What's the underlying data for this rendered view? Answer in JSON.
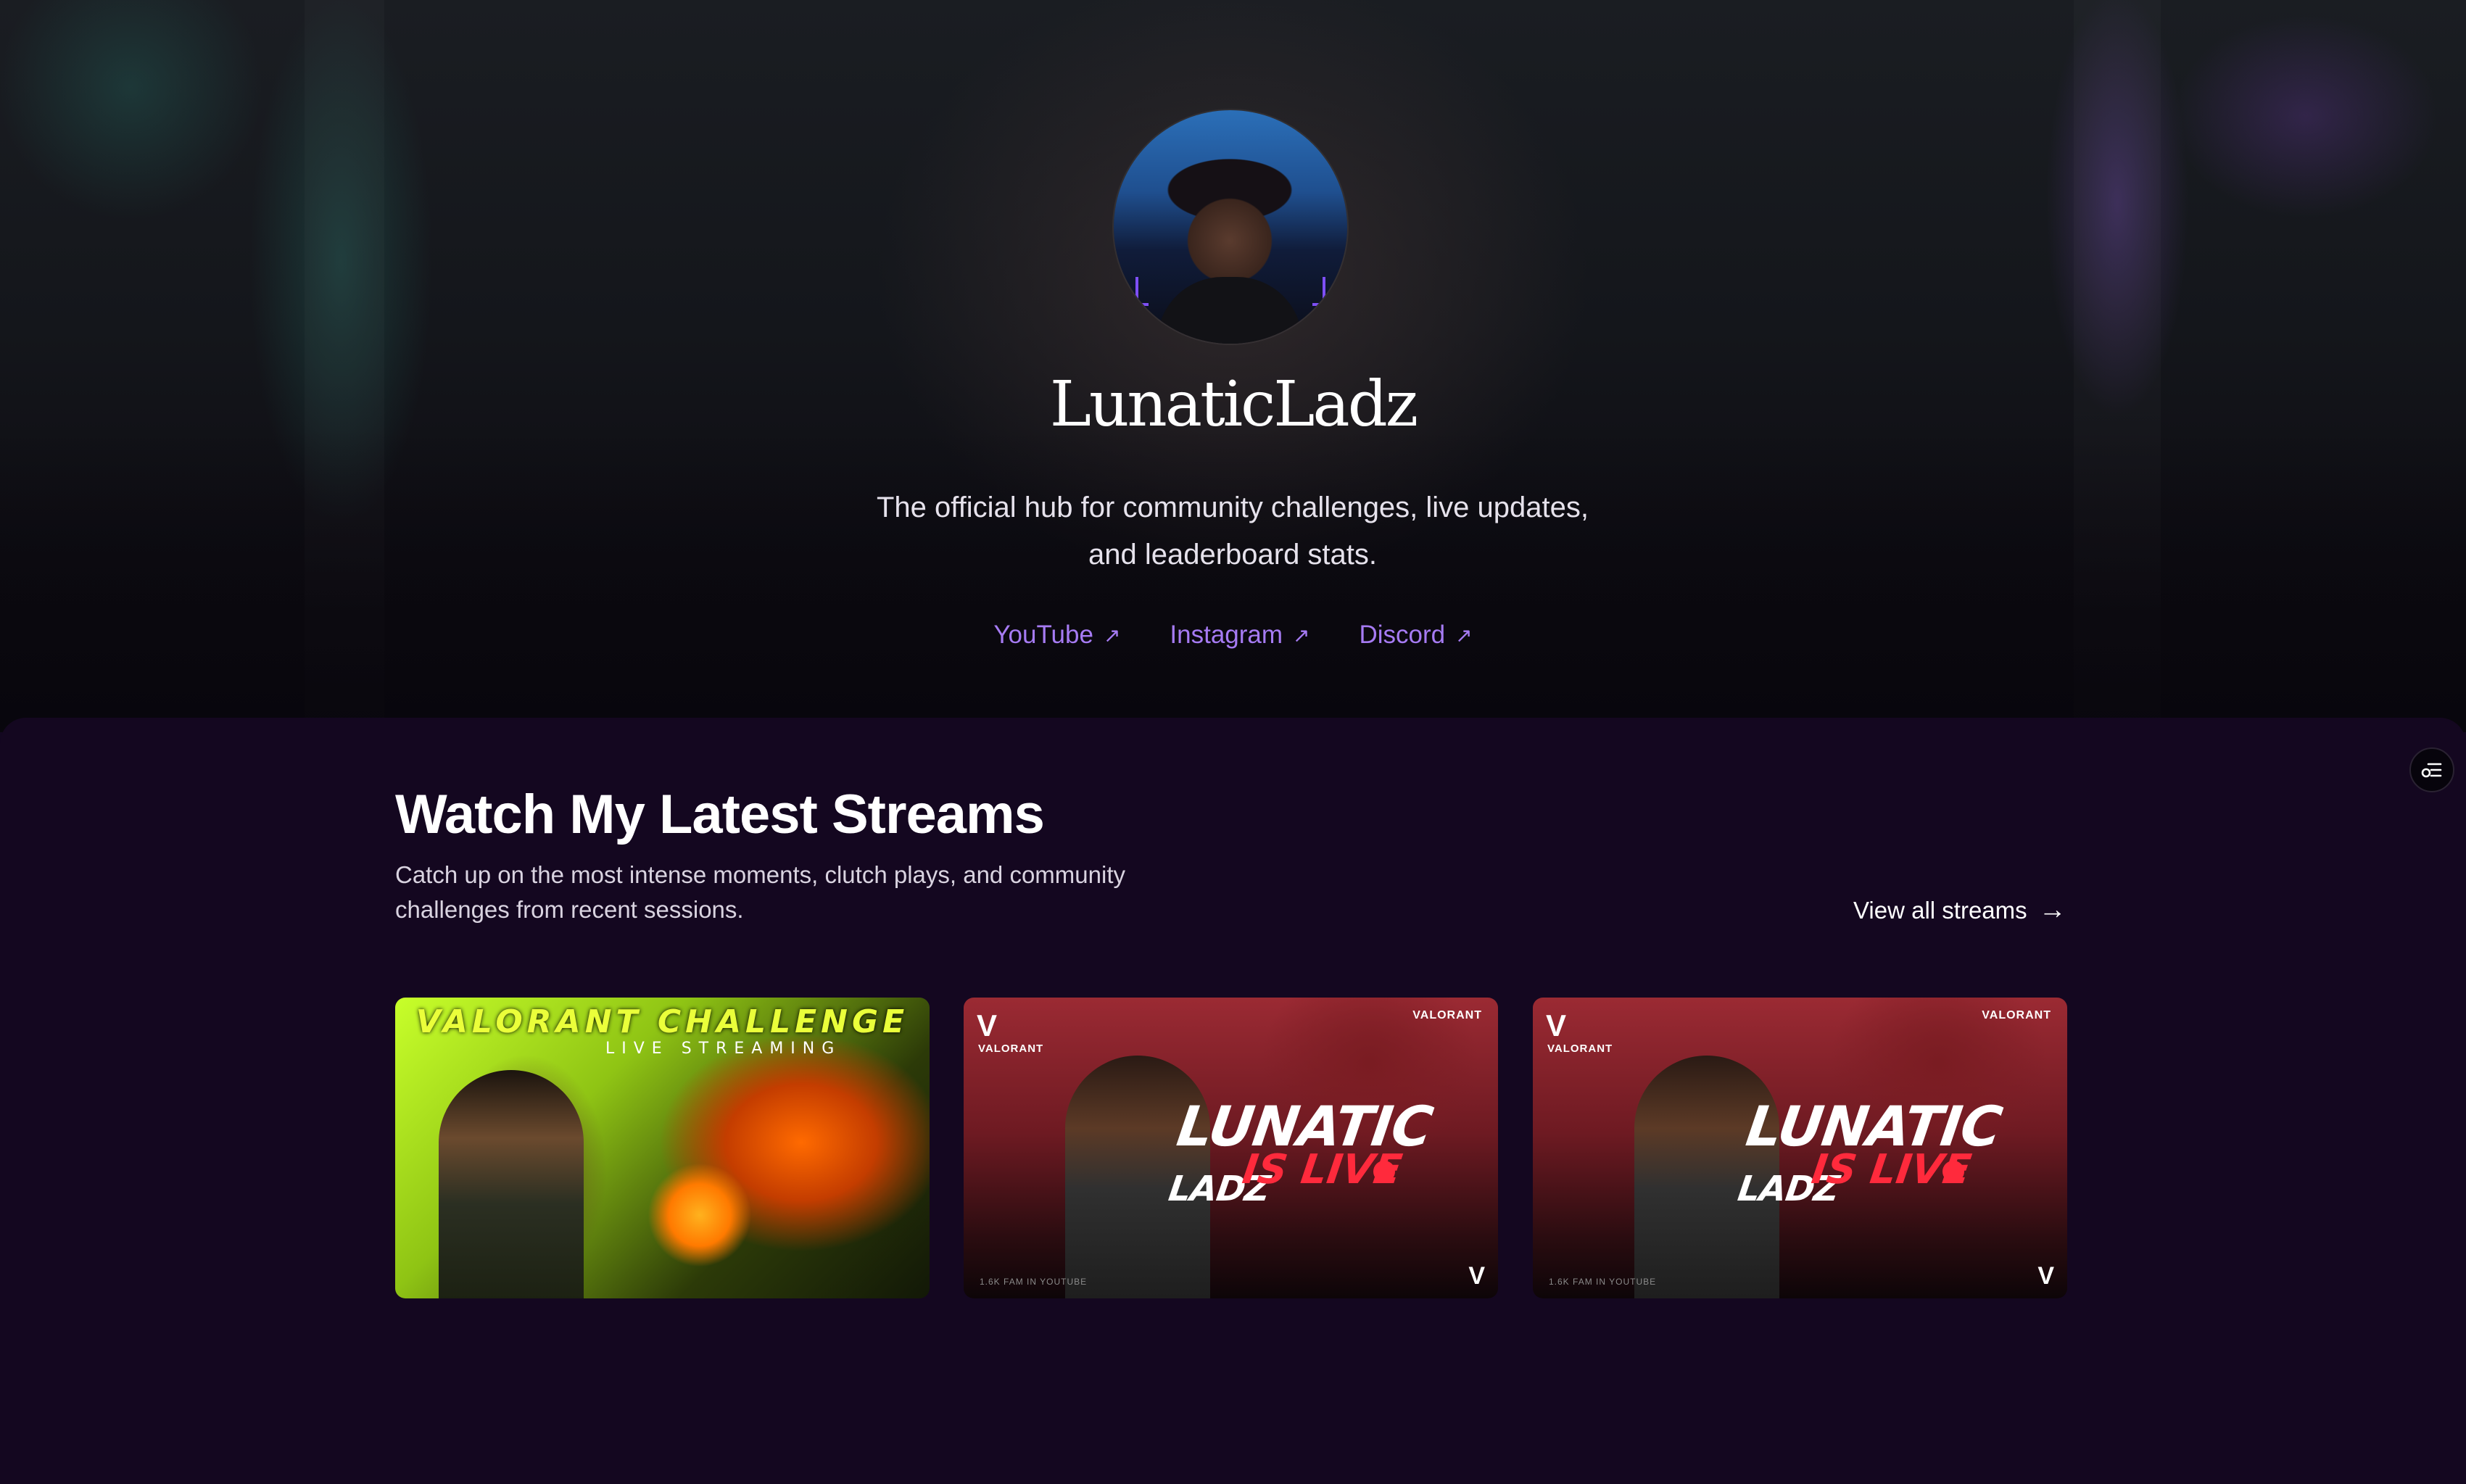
{
  "profile": {
    "name": "LunaticLadz",
    "tagline_line1": "The official hub for community challenges, live updates,",
    "tagline_line2": "and leaderboard stats."
  },
  "social_links": [
    {
      "label": "YouTube",
      "arrow": "↗"
    },
    {
      "label": "Instagram",
      "arrow": "↗"
    },
    {
      "label": "Discord",
      "arrow": "↗"
    }
  ],
  "streams_section": {
    "title": "Watch My Latest Streams",
    "subtitle_line1": "Catch up on the most intense moments, clutch plays, and community",
    "subtitle_line2": "challenges from recent sessions.",
    "view_all": "View all streams",
    "view_all_arrow": "→"
  },
  "stream_cards": [
    {
      "heading": "VALORANT CHALLENGE",
      "subheading": "LIVE STREAMING"
    },
    {
      "brand_left": "VALORANT",
      "brand_right": "VALORANT",
      "title": "LUNATIC",
      "title_small": "LADZ",
      "live_text": "IS LIVE",
      "footer": "1.6K FAM IN YOUTUBE"
    },
    {
      "brand_left": "VALORANT",
      "brand_right": "VALORANT",
      "title": "LUNATIC",
      "title_small": "LADZ",
      "live_text": "IS LIVE",
      "footer": "1.6K FAM IN YOUTUBE"
    }
  ],
  "colors": {
    "accent_link": "#a67bf3",
    "panel_bg": "#140720",
    "live_red": "#ff2a3c"
  },
  "icons": {
    "float_button": "filter-settings-icon",
    "link_arrow": "external-arrow-icon"
  }
}
